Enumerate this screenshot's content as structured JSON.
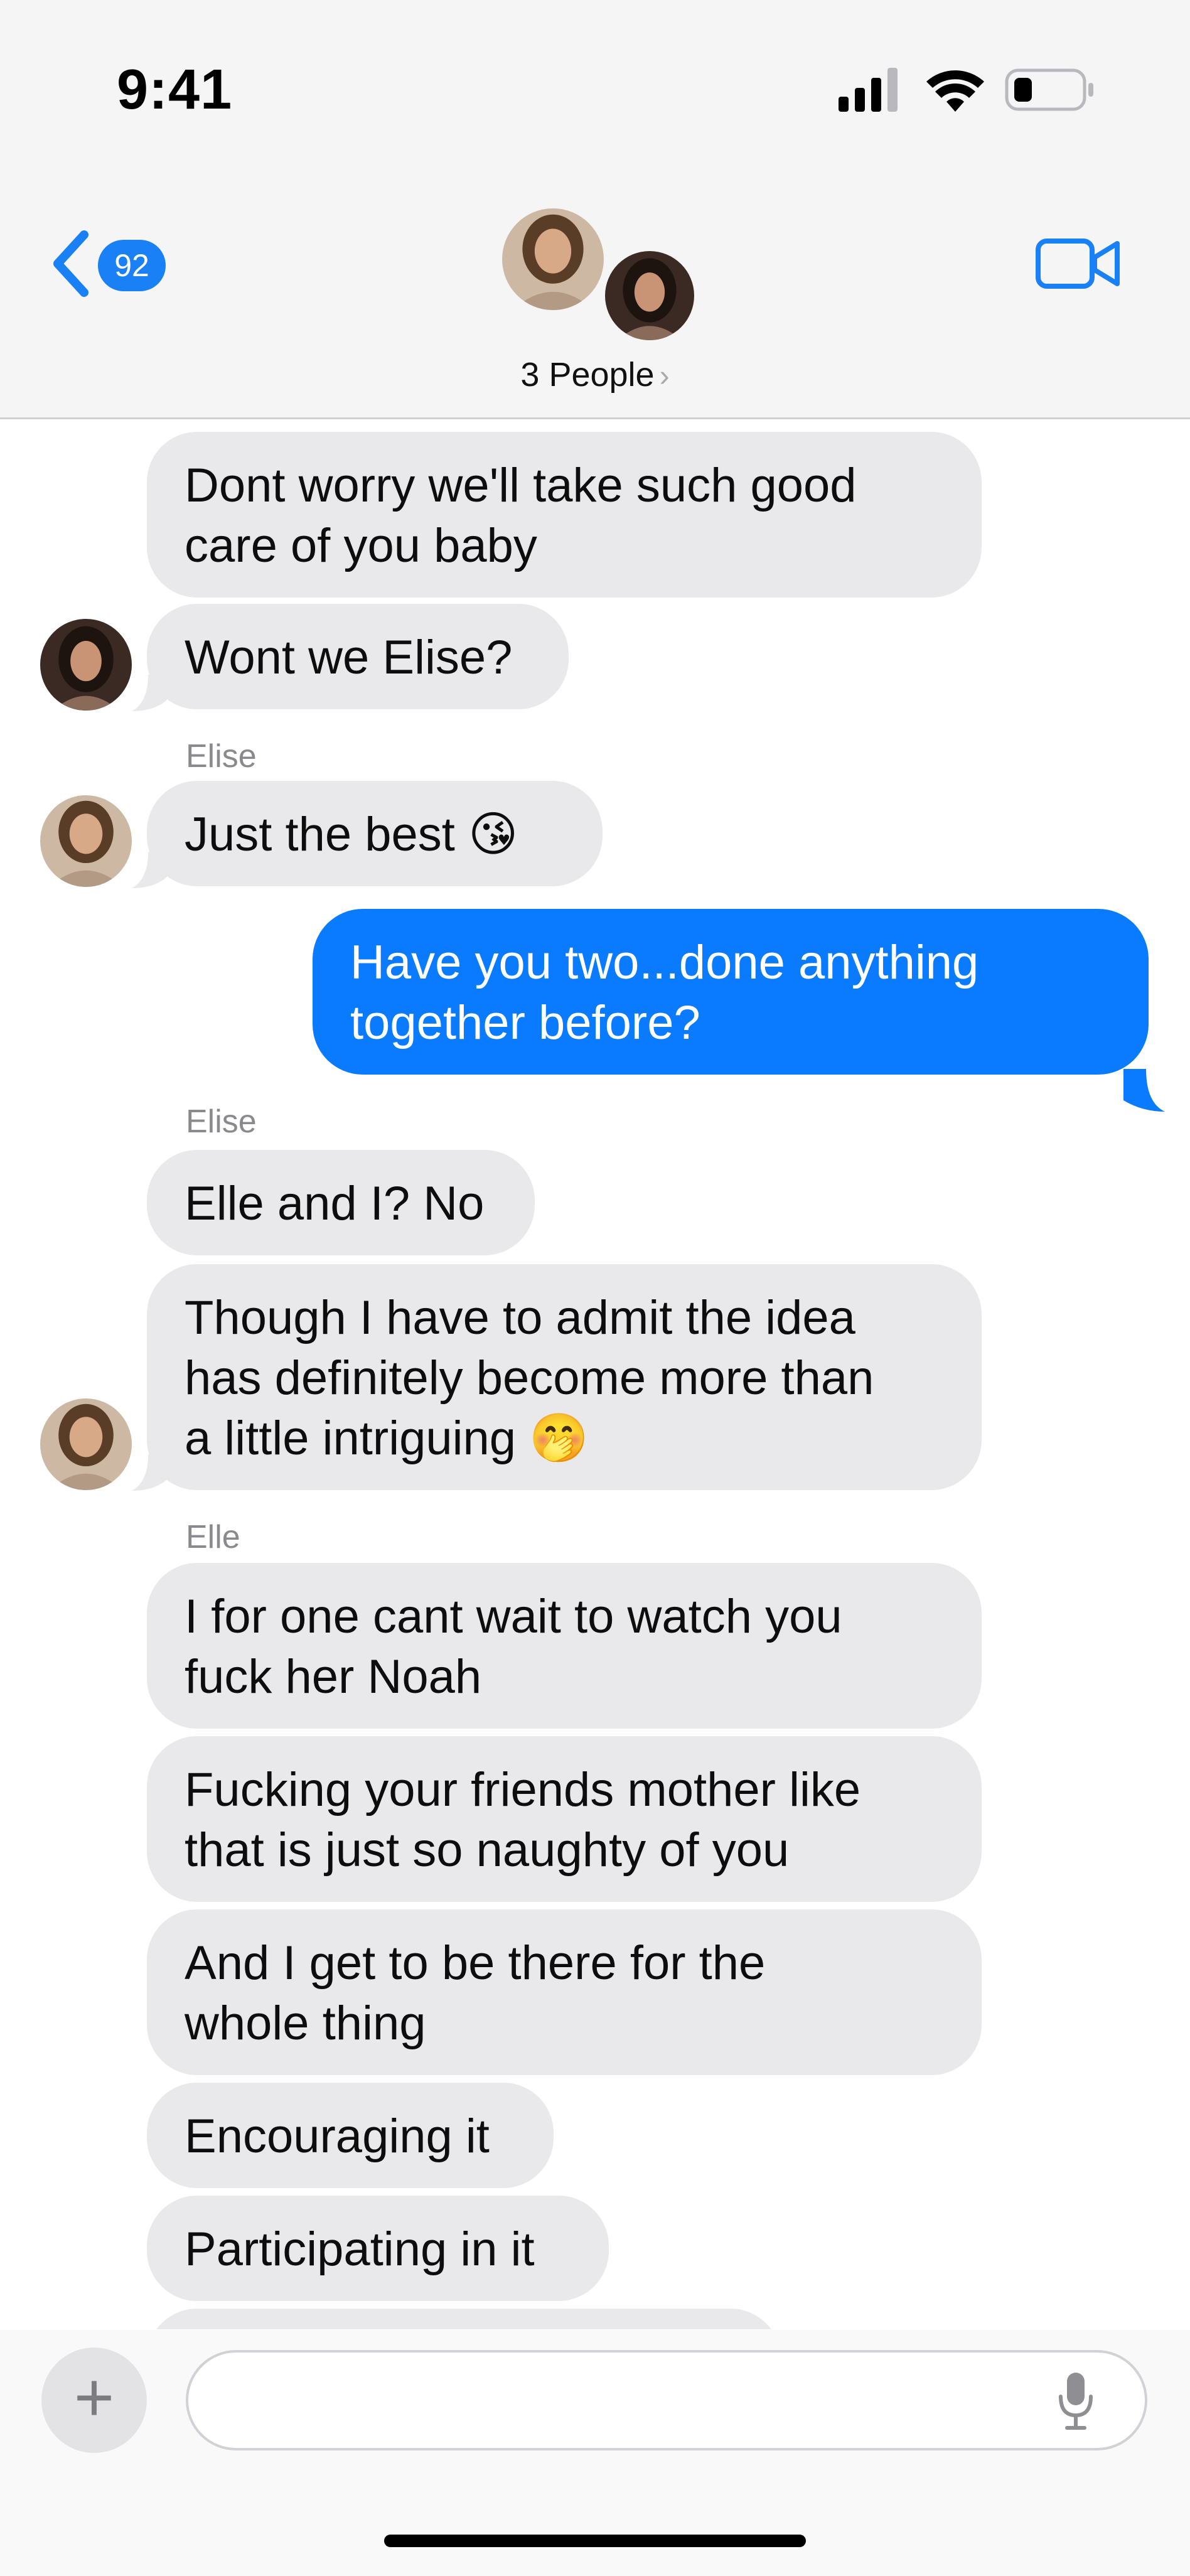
{
  "status_bar": {
    "time": "9:41"
  },
  "header": {
    "unread_count": "92",
    "group_label": "3 People",
    "chevron": "›"
  },
  "messages": [
    {
      "id": "m1",
      "direction": "incoming",
      "text": "Dont worry we'll take such good\ncare of you baby"
    },
    {
      "id": "m2",
      "direction": "incoming",
      "text": "Wont we Elise?"
    },
    {
      "id": "s1",
      "sender": "Elise"
    },
    {
      "id": "m3",
      "direction": "incoming",
      "text": "Just the best 😘"
    },
    {
      "id": "m4",
      "direction": "outgoing",
      "text": "Have you two...done anything\ntogether before?"
    },
    {
      "id": "s2",
      "sender": "Elise"
    },
    {
      "id": "m5",
      "direction": "incoming",
      "text": "Elle and I? No"
    },
    {
      "id": "m6",
      "direction": "incoming",
      "text": "Though I have to admit the idea\nhas definitely become more than\na little intriguing   🤭"
    },
    {
      "id": "s3",
      "sender": "Elle"
    },
    {
      "id": "m7",
      "direction": "incoming",
      "text": "I for one cant wait to watch you\nfuck her Noah"
    },
    {
      "id": "m8",
      "direction": "incoming",
      "text": "Fucking your friends mother like\nthat is just so naughty of you"
    },
    {
      "id": "m9",
      "direction": "incoming",
      "text": "And I get to be there for the\nwhole thing"
    },
    {
      "id": "m10",
      "direction": "incoming",
      "text": "Encouraging it"
    },
    {
      "id": "m11",
      "direction": "incoming",
      "text": "Participating in it"
    }
  ],
  "input": {
    "placeholder": ""
  },
  "colors": {
    "incoming_bubble": "#e9e9eb",
    "outgoing_bubble": "#0a7bff",
    "accent": "#1a80f5"
  },
  "icons": [
    "back-chevron-icon",
    "video-camera-icon",
    "plus-icon",
    "microphone-icon",
    "signal-icon",
    "wifi-icon",
    "battery-icon"
  ]
}
